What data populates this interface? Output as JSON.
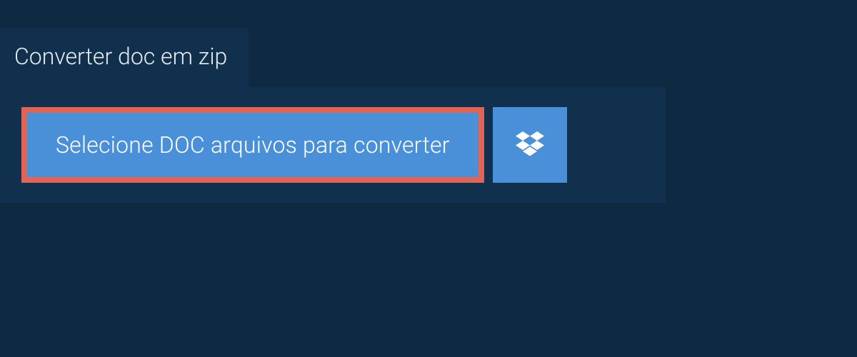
{
  "header": {
    "title": "Converter doc em zip"
  },
  "actions": {
    "select_label": "Selecione DOC arquivos para converter"
  },
  "colors": {
    "page_bg": "#0e2a42",
    "panel_bg": "#10304d",
    "button_bg": "#4a90d9",
    "highlight_border": "#e06556"
  }
}
